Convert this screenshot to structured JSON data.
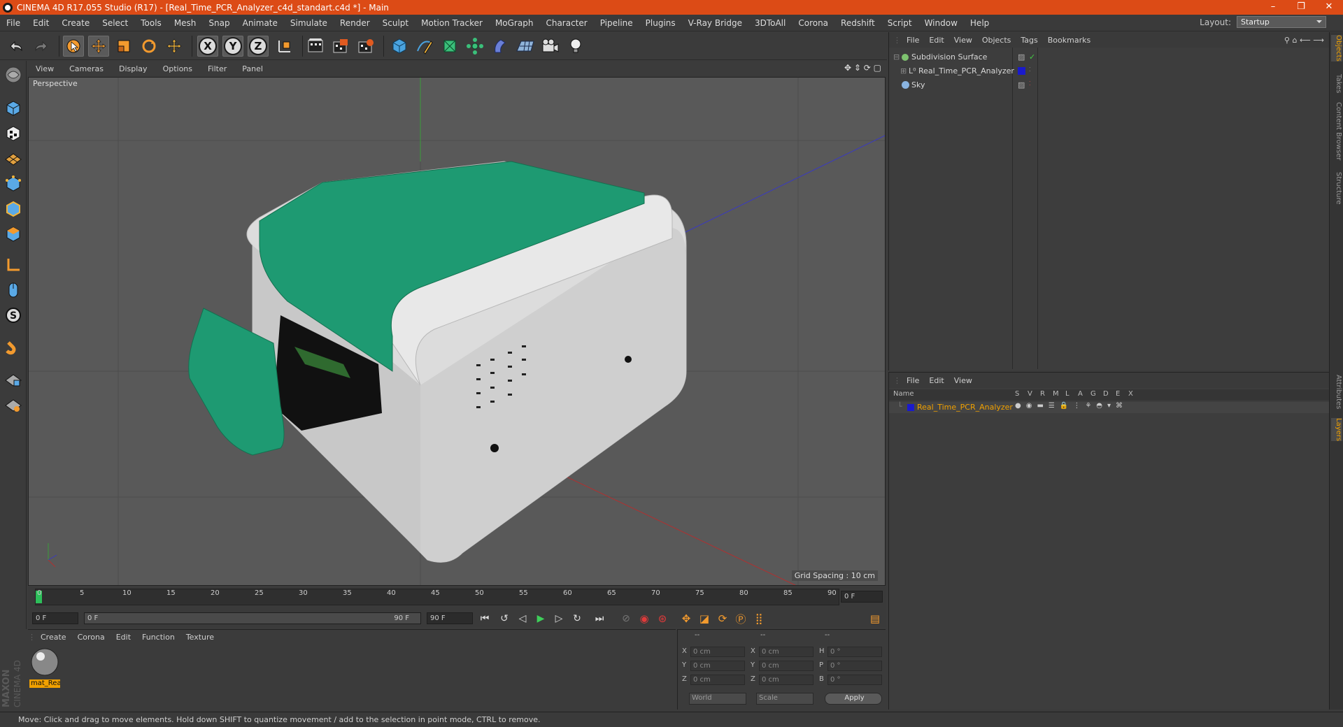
{
  "window": {
    "title": "CINEMA 4D R17.055 Studio (R17) - [Real_Time_PCR_Analyzer_c4d_standart.c4d *] - Main",
    "controls": [
      "–",
      "❐",
      "✕"
    ]
  },
  "menubar": {
    "items": [
      "File",
      "Edit",
      "Create",
      "Select",
      "Tools",
      "Mesh",
      "Snap",
      "Animate",
      "Simulate",
      "Render",
      "Sculpt",
      "Motion Tracker",
      "MoGraph",
      "Character",
      "Pipeline",
      "Plugins",
      "V-Ray Bridge",
      "3DToAll",
      "Corona",
      "Redshift",
      "Script",
      "Window",
      "Help"
    ],
    "layout_label": "Layout:",
    "layout_value": "Startup"
  },
  "toolbar": {
    "axis_x": "X",
    "axis_y": "Y",
    "axis_z": "Z"
  },
  "viewport": {
    "menu": [
      "View",
      "Cameras",
      "Display",
      "Options",
      "Filter",
      "Panel"
    ],
    "camera_label": "Perspective",
    "grid_spacing": "Grid Spacing : 10 cm"
  },
  "timeline": {
    "ticks": [
      "0",
      "5",
      "10",
      "15",
      "20",
      "25",
      "30",
      "35",
      "40",
      "45",
      "50",
      "55",
      "60",
      "65",
      "70",
      "75",
      "80",
      "85",
      "90"
    ],
    "current_frame": "0 F",
    "start_field": "0 F",
    "range_start": "0 F",
    "range_end": "90 F",
    "end_field": "90 F"
  },
  "material_panel": {
    "menu": [
      "Create",
      "Corona",
      "Edit",
      "Function",
      "Texture"
    ],
    "material_name": "mat_Rea"
  },
  "coordinates": {
    "headers": [
      "--",
      "--",
      "--"
    ],
    "rows": [
      {
        "l1": "X",
        "v1": "0 cm",
        "l2": "X",
        "v2": "0 cm",
        "l3": "H",
        "v3": "0 °"
      },
      {
        "l1": "Y",
        "v1": "0 cm",
        "l2": "Y",
        "v2": "0 cm",
        "l3": "P",
        "v3": "0 °"
      },
      {
        "l1": "Z",
        "v1": "0 cm",
        "l2": "Z",
        "v2": "0 cm",
        "l3": "B",
        "v3": "0 °"
      }
    ],
    "mode1": "World",
    "mode2": "Scale",
    "apply": "Apply"
  },
  "object_manager": {
    "menu": [
      "File",
      "Edit",
      "View",
      "Objects",
      "Tags",
      "Bookmarks"
    ],
    "objects": [
      {
        "name": "Subdivision Surface",
        "color": "#7ec26f"
      },
      {
        "name": "Real_Time_PCR_Analyzer",
        "color": "#1a1acc"
      },
      {
        "name": "Sky",
        "color": "#8ab4e0"
      }
    ]
  },
  "layer_manager": {
    "menu": [
      "File",
      "Edit",
      "View"
    ],
    "col_name": "Name",
    "columns": [
      "S",
      "V",
      "R",
      "M",
      "L",
      "A",
      "G",
      "D",
      "E",
      "X"
    ],
    "layer_name": "Real_Time_PCR_Analyzer",
    "layer_color": "#1a1acc"
  },
  "right_tabs": [
    "Objects",
    "Takes",
    "Content Browser",
    "Structure",
    "Attributes",
    "Layers"
  ],
  "brand": {
    "line1": "MAXON",
    "line2": "CINEMA 4D"
  },
  "status": "Move: Click and drag to move elements. Hold down SHIFT to quantize movement / add to the selection in point mode, CTRL to remove.",
  "colors": {
    "accent": "#dc4b16",
    "device_green": "#1e9a72",
    "device_body": "#e6e6e6",
    "highlight": "#f0a000"
  }
}
